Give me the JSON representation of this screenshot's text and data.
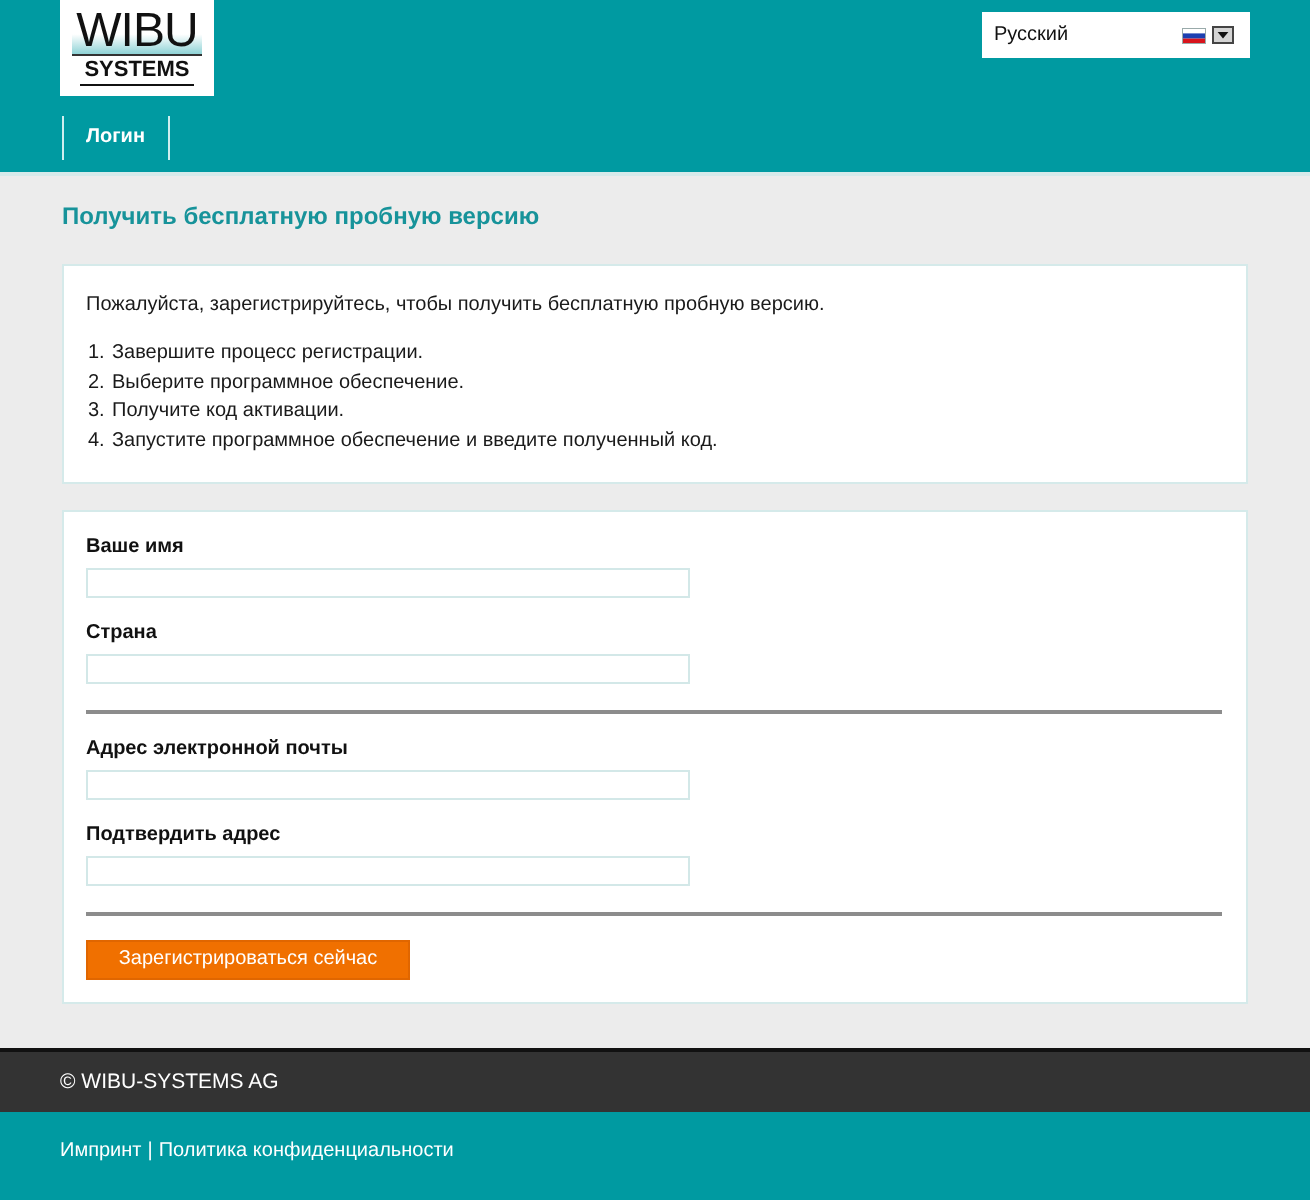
{
  "header": {
    "logo": {
      "wordmark": "WIBU",
      "subtitle": "SYSTEMS"
    },
    "language": {
      "value": "Русский"
    },
    "nav": [
      {
        "label": "Логин"
      }
    ]
  },
  "page": {
    "title": "Получить бесплатную пробную версию"
  },
  "intro": {
    "text": "Пожалуйста, зарегистрируйтесь, чтобы получить бесплатную пробную версию.",
    "steps": [
      {
        "number": "1.",
        "text": "Завершите процесс регистрации."
      },
      {
        "number": "2.",
        "text": "Выберите программное обеспечение."
      },
      {
        "number": "3.",
        "text": "Получите код активации."
      },
      {
        "number": "4.",
        "text": "Запустите программное обеспечение и введите полученный код."
      }
    ]
  },
  "form": {
    "groups": [
      {
        "fields": [
          {
            "label": "Ваше имя"
          },
          {
            "label": "Страна"
          }
        ]
      },
      {
        "fields": [
          {
            "label": "Адрес электронной почты"
          },
          {
            "label": "Подтвердить адрес"
          }
        ]
      }
    ],
    "submit": "Зарегистрироваться сейчас"
  },
  "footer": {
    "copyright": "© WIBU-SYSTEMS AG",
    "links": [
      "Импринт",
      "Политика конфиденциальности"
    ],
    "separator": "|"
  }
}
